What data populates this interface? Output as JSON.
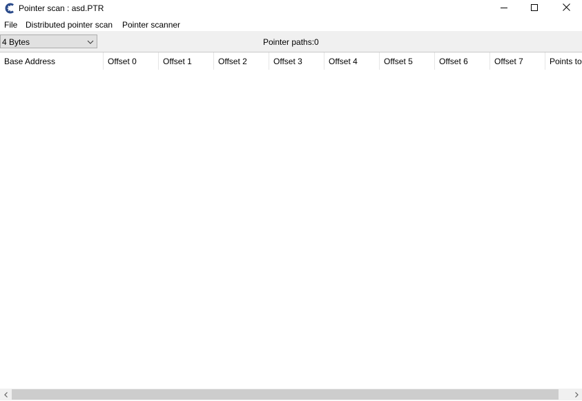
{
  "window": {
    "title": "Pointer scan : asd.PTR",
    "app_icon": "cheat-engine-icon",
    "controls": {
      "minimize_icon": "minimize-icon",
      "maximize_icon": "maximize-icon",
      "close_icon": "close-icon"
    }
  },
  "menu": {
    "items": [
      {
        "label": "File"
      },
      {
        "label": "Distributed pointer scan"
      },
      {
        "label": "Pointer scanner"
      }
    ]
  },
  "toolbar": {
    "value_type": "4 Bytes",
    "paths_label": "Pointer paths:0"
  },
  "table": {
    "columns": [
      {
        "label": "Base Address"
      },
      {
        "label": "Offset 0"
      },
      {
        "label": "Offset 1"
      },
      {
        "label": "Offset 2"
      },
      {
        "label": "Offset 3"
      },
      {
        "label": "Offset 4"
      },
      {
        "label": "Offset 5"
      },
      {
        "label": "Offset 6"
      },
      {
        "label": "Offset 7"
      },
      {
        "label": "Points to"
      }
    ],
    "rows": []
  },
  "scrollbar": {
    "left_icon": "chevron-left-icon",
    "right_icon": "chevron-right-icon"
  },
  "colors": {
    "toolbar_bg": "#f0f0f0",
    "select_bg": "#e1e1e1",
    "scroll_thumb": "#cdcdcd"
  }
}
